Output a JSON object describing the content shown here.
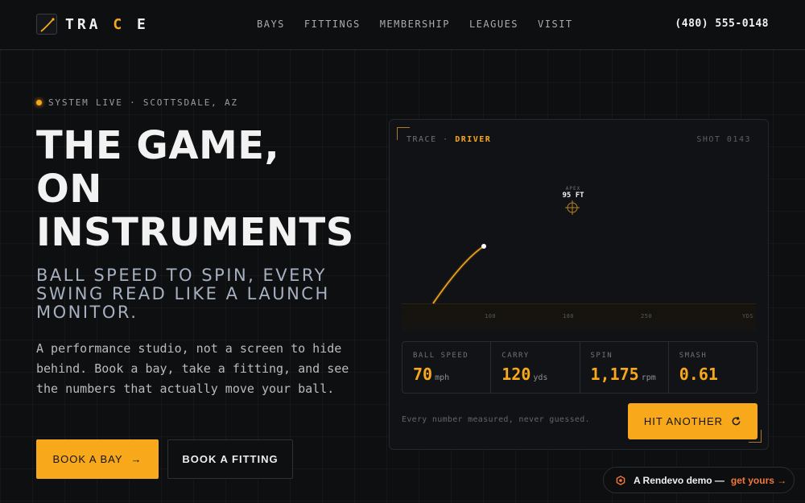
{
  "brand": {
    "logo_text_1": "TRA",
    "logo_text_accent": "C",
    "logo_text_2": "E"
  },
  "nav": {
    "links": [
      "BAYS",
      "FITTINGS",
      "MEMBERSHIP",
      "LEAGUES",
      "VISIT"
    ],
    "phone": "(480) 555-0148"
  },
  "hero": {
    "status": "SYSTEM LIVE · SCOTTSDALE, AZ",
    "headline_lines": [
      "THE GAME,",
      "ON",
      "INSTRUMENTS"
    ],
    "subhead": "BALL SPEED TO SPIN, EVERY SWING READ LIKE A LAUNCH MONITOR.",
    "body": "A performance studio, not a screen to hide behind. Book a bay, take a fitting, and see the numbers that actually move your ball.",
    "primary_cta": "BOOK A BAY",
    "primary_cta_arrow": "→",
    "secondary_cta": "BOOK A FITTING"
  },
  "panel": {
    "label_prefix": "TRACE ·",
    "club": "DRIVER",
    "shot": "SHOT 0143",
    "apex_caption": "APEX",
    "apex_value": "95 FT",
    "axis_ticks": [
      "100",
      "180",
      "250",
      "YDS"
    ],
    "metrics": [
      {
        "label": "BALL SPEED",
        "value": "70",
        "unit": "mph"
      },
      {
        "label": "CARRY",
        "value": "120",
        "unit": "yds"
      },
      {
        "label": "SPIN",
        "value": "1,175",
        "unit": "rpm"
      },
      {
        "label": "SMASH",
        "value": "0.61",
        "unit": ""
      }
    ],
    "footnote": "Every number measured, never guessed.",
    "action": "HIT ANOTHER",
    "action_icon": "refresh-icon",
    "accent_color": "#f7a81b"
  },
  "demo_badge": {
    "text": "A Rendevo demo —",
    "link": "get yours →",
    "link_color": "#f2783a"
  }
}
